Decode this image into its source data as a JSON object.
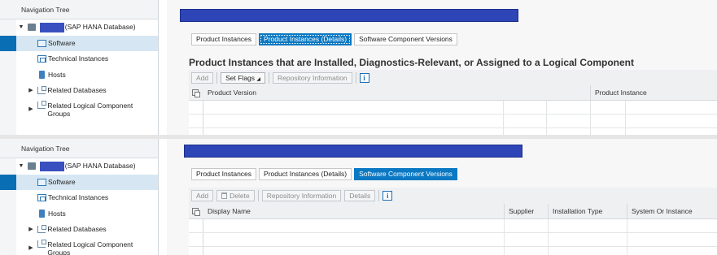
{
  "panels": [
    {
      "nav": {
        "title": "Navigation Tree",
        "root": {
          "label": "(SAP HANA Database)",
          "expand": "▼"
        },
        "items": [
          {
            "label": "Software",
            "icon": "software-icon",
            "selected": true
          },
          {
            "label": "Technical Instances",
            "icon": "technical-instances-icon"
          },
          {
            "label": "Hosts",
            "icon": "host-icon"
          },
          {
            "label": "Related Databases",
            "icon": "tree-icon",
            "expand": "▶"
          },
          {
            "label": "Related Logical Component Groups",
            "icon": "tree-icon",
            "expand": "▶"
          }
        ]
      },
      "tabs": [
        "Product Instances",
        "Product Instances (Details)",
        "Software Component Versions"
      ],
      "active_tab": 1,
      "section_title": "Product Instances that are Installed, Diagnostics-Relevant, or Assigned to a Logical Component",
      "toolbar": {
        "add": "Add",
        "set_flags": "Set Flags",
        "repository_info": "Repository Information"
      },
      "columns": [
        "Product Version",
        "Product Instance"
      ]
    },
    {
      "nav": {
        "title": "Navigation Tree",
        "root": {
          "label": "(SAP HANA Database)",
          "expand": "▼"
        },
        "items": [
          {
            "label": "Software",
            "icon": "software-icon",
            "selected": true
          },
          {
            "label": "Technical Instances",
            "icon": "technical-instances-icon"
          },
          {
            "label": "Hosts",
            "icon": "host-icon"
          },
          {
            "label": "Related Databases",
            "icon": "tree-icon",
            "expand": "▶"
          },
          {
            "label": "Related Logical Component Groups",
            "icon": "tree-icon",
            "expand": "▶"
          }
        ]
      },
      "tabs": [
        "Product Instances",
        "Product Instances (Details)",
        "Software Component Versions"
      ],
      "active_tab": 2,
      "toolbar": {
        "add": "Add",
        "delete": "Delete",
        "repository_info": "Repository Information",
        "details": "Details"
      },
      "columns": [
        "Display Name",
        "Supplier",
        "Installation Type",
        "System Or Instance"
      ]
    }
  ],
  "colors": {
    "accent": "#0a78c2",
    "selection": "#d6e7f3",
    "redaction": "#2e45b8"
  },
  "info_icon": "i"
}
